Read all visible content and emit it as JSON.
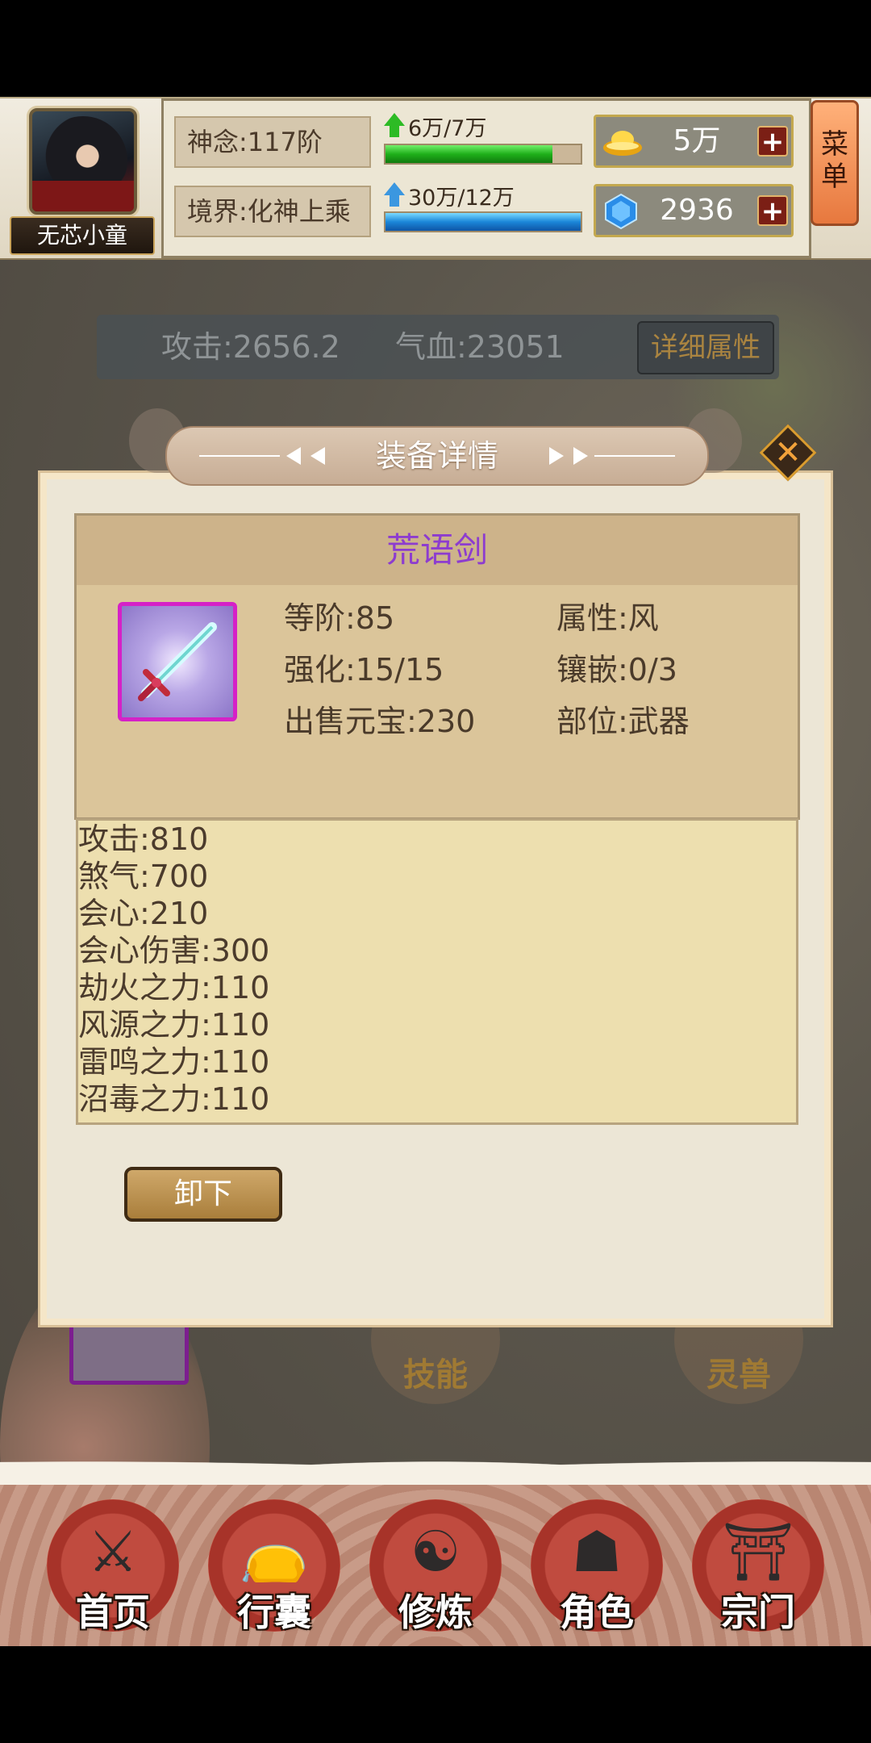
{
  "player": {
    "name": "无芯小童",
    "shennian_label": "神念:117阶",
    "realm_label": "境界:化神上乘",
    "shennian_progress_text": "6万/7万",
    "shennian_progress": 0.857,
    "realm_progress_text": "30万/12万",
    "realm_progress": 1.0
  },
  "currency": {
    "gold_value": "5万",
    "gem_value": "2936",
    "plus_label": "+"
  },
  "menu": {
    "label_line1": "菜",
    "label_line2": "单"
  },
  "summary": {
    "attack": "攻击:2656.2",
    "hp": "气血:23051",
    "detail_button": "详细属性"
  },
  "modal": {
    "title": "装备详情",
    "close_label": "✕",
    "item": {
      "name": "荒语剑",
      "name_color": "#8d3ccf",
      "level": "等阶:85",
      "element": "属性:风",
      "enhance": "强化:15/15",
      "inlay": "镶嵌:0/3",
      "sell_price": "出售元宝:230",
      "slot": "部位:武器",
      "icon": "sword-icon"
    },
    "stats": [
      "攻击:810",
      "煞气:700",
      "会心:210",
      "会心伤害:300",
      "劫火之力:110",
      "风源之力:110",
      "雷鸣之力:110",
      "沼毒之力:110"
    ],
    "unequip_button": "卸下"
  },
  "background_peek": {
    "skill_label": "技能",
    "pet_label": "灵兽"
  },
  "nav": {
    "items": [
      {
        "label": "首页",
        "icon": "crossed-swords-icon"
      },
      {
        "label": "行囊",
        "icon": "bag-icon"
      },
      {
        "label": "修炼",
        "icon": "meditation-icon"
      },
      {
        "label": "角色",
        "icon": "character-icon"
      },
      {
        "label": "宗门",
        "icon": "gate-icon"
      }
    ]
  }
}
